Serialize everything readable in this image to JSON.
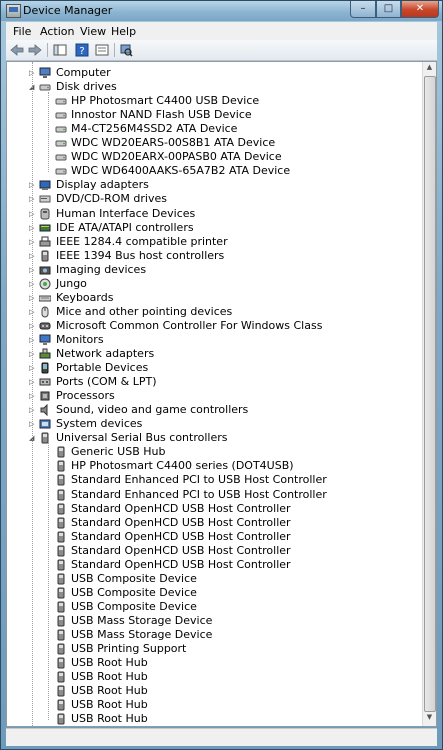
{
  "window": {
    "title": "Device Manager"
  },
  "controls": {
    "minimize": "–",
    "maximize": "□",
    "close": "✕"
  },
  "menu": {
    "items": [
      "File",
      "Action",
      "View",
      "Help"
    ]
  },
  "toolbar": {
    "icons": [
      "back-arrow-icon",
      "forward-arrow-icon",
      "show-hide-tree-icon",
      "help-icon",
      "properties-icon",
      "scan-hardware-icon"
    ]
  },
  "tree": [
    {
      "type": "cat",
      "label": "Computer",
      "expanded": false,
      "icon": "computer"
    },
    {
      "type": "cat",
      "label": "Disk drives",
      "expanded": true,
      "icon": "disk"
    },
    {
      "type": "dev",
      "label": "HP Photosmart C4400 USB Device",
      "icon": "disk"
    },
    {
      "type": "dev",
      "label": "Innostor NAND Flash USB Device",
      "icon": "disk"
    },
    {
      "type": "dev",
      "label": "M4-CT256M4SSD2 ATA Device",
      "icon": "disk"
    },
    {
      "type": "dev",
      "label": "WDC WD20EARS-00S8B1 ATA Device",
      "icon": "disk"
    },
    {
      "type": "dev",
      "label": "WDC WD20EARX-00PASB0 ATA Device",
      "icon": "disk"
    },
    {
      "type": "dev",
      "label": "WDC WD6400AAKS-65A7B2 ATA Device",
      "icon": "disk"
    },
    {
      "type": "cat",
      "label": "Display adapters",
      "expanded": false,
      "icon": "display"
    },
    {
      "type": "cat",
      "label": "DVD/CD-ROM drives",
      "expanded": false,
      "icon": "dvd"
    },
    {
      "type": "cat",
      "label": "Human Interface Devices",
      "expanded": false,
      "icon": "hid"
    },
    {
      "type": "cat",
      "label": "IDE ATA/ATAPI controllers",
      "expanded": false,
      "icon": "ide"
    },
    {
      "type": "cat",
      "label": "IEEE 1284.4 compatible printer",
      "expanded": false,
      "icon": "printer"
    },
    {
      "type": "cat",
      "label": "IEEE 1394 Bus host controllers",
      "expanded": false,
      "icon": "usb"
    },
    {
      "type": "cat",
      "label": "Imaging devices",
      "expanded": false,
      "icon": "camera"
    },
    {
      "type": "cat",
      "label": "Jungo",
      "expanded": false,
      "icon": "jungo"
    },
    {
      "type": "cat",
      "label": "Keyboards",
      "expanded": false,
      "icon": "keyboard"
    },
    {
      "type": "cat",
      "label": "Mice and other pointing devices",
      "expanded": false,
      "icon": "mouse"
    },
    {
      "type": "cat",
      "label": "Microsoft Common Controller For Windows Class",
      "expanded": false,
      "icon": "controller"
    },
    {
      "type": "cat",
      "label": "Monitors",
      "expanded": false,
      "icon": "monitor"
    },
    {
      "type": "cat",
      "label": "Network adapters",
      "expanded": false,
      "icon": "network"
    },
    {
      "type": "cat",
      "label": "Portable Devices",
      "expanded": false,
      "icon": "portable"
    },
    {
      "type": "cat",
      "label": "Ports (COM & LPT)",
      "expanded": false,
      "icon": "port"
    },
    {
      "type": "cat",
      "label": "Processors",
      "expanded": false,
      "icon": "cpu"
    },
    {
      "type": "cat",
      "label": "Sound, video and game controllers",
      "expanded": false,
      "icon": "sound"
    },
    {
      "type": "cat",
      "label": "System devices",
      "expanded": false,
      "icon": "system"
    },
    {
      "type": "cat",
      "label": "Universal Serial Bus controllers",
      "expanded": true,
      "icon": "usb"
    },
    {
      "type": "dev",
      "label": "Generic USB Hub",
      "icon": "usb"
    },
    {
      "type": "dev",
      "label": "HP Photosmart C4400 series (DOT4USB)",
      "icon": "usb"
    },
    {
      "type": "dev",
      "label": "Standard Enhanced PCI to USB Host Controller",
      "icon": "usb"
    },
    {
      "type": "dev",
      "label": "Standard Enhanced PCI to USB Host Controller",
      "icon": "usb"
    },
    {
      "type": "dev",
      "label": "Standard OpenHCD USB Host Controller",
      "icon": "usb"
    },
    {
      "type": "dev",
      "label": "Standard OpenHCD USB Host Controller",
      "icon": "usb"
    },
    {
      "type": "dev",
      "label": "Standard OpenHCD USB Host Controller",
      "icon": "usb"
    },
    {
      "type": "dev",
      "label": "Standard OpenHCD USB Host Controller",
      "icon": "usb"
    },
    {
      "type": "dev",
      "label": "Standard OpenHCD USB Host Controller",
      "icon": "usb"
    },
    {
      "type": "dev",
      "label": "USB Composite Device",
      "icon": "usb"
    },
    {
      "type": "dev",
      "label": "USB Composite Device",
      "icon": "usb"
    },
    {
      "type": "dev",
      "label": "USB Composite Device",
      "icon": "usb"
    },
    {
      "type": "dev",
      "label": "USB Mass Storage Device",
      "icon": "usb"
    },
    {
      "type": "dev",
      "label": "USB Mass Storage Device",
      "icon": "usb"
    },
    {
      "type": "dev",
      "label": "USB Printing Support",
      "icon": "usb"
    },
    {
      "type": "dev",
      "label": "USB Root Hub",
      "icon": "usb"
    },
    {
      "type": "dev",
      "label": "USB Root Hub",
      "icon": "usb"
    },
    {
      "type": "dev",
      "label": "USB Root Hub",
      "icon": "usb"
    },
    {
      "type": "dev",
      "label": "USB Root Hub",
      "icon": "usb"
    },
    {
      "type": "dev",
      "label": "USB Root Hub",
      "icon": "usb"
    }
  ],
  "scrollbar": {
    "up": "▲",
    "down": "▼"
  }
}
